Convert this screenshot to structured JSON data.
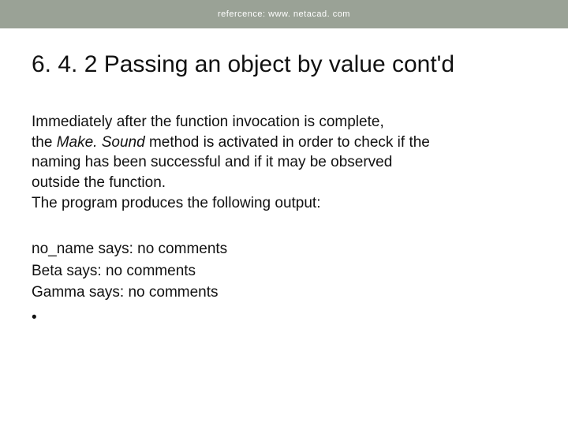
{
  "header": {
    "reference_text": "refercence: www. netacad. com"
  },
  "title": "6. 4. 2 Passing an object by value cont'd",
  "paragraph": {
    "line1_part1": "Immediately after the function invocation is complete,",
    "line2_part1": "the ",
    "line2_italic": "Make. Sound",
    "line2_part2": " method is activated in order to check if the",
    "line3": "naming has been successful and if it may be observed",
    "line4": "outside the function.",
    "line5": "The program produces the following output:"
  },
  "output": {
    "line1": "no_name says: no comments",
    "line2": "Beta says: no comments",
    "line3": "Gamma says: no comments"
  },
  "bullet_char": "•"
}
